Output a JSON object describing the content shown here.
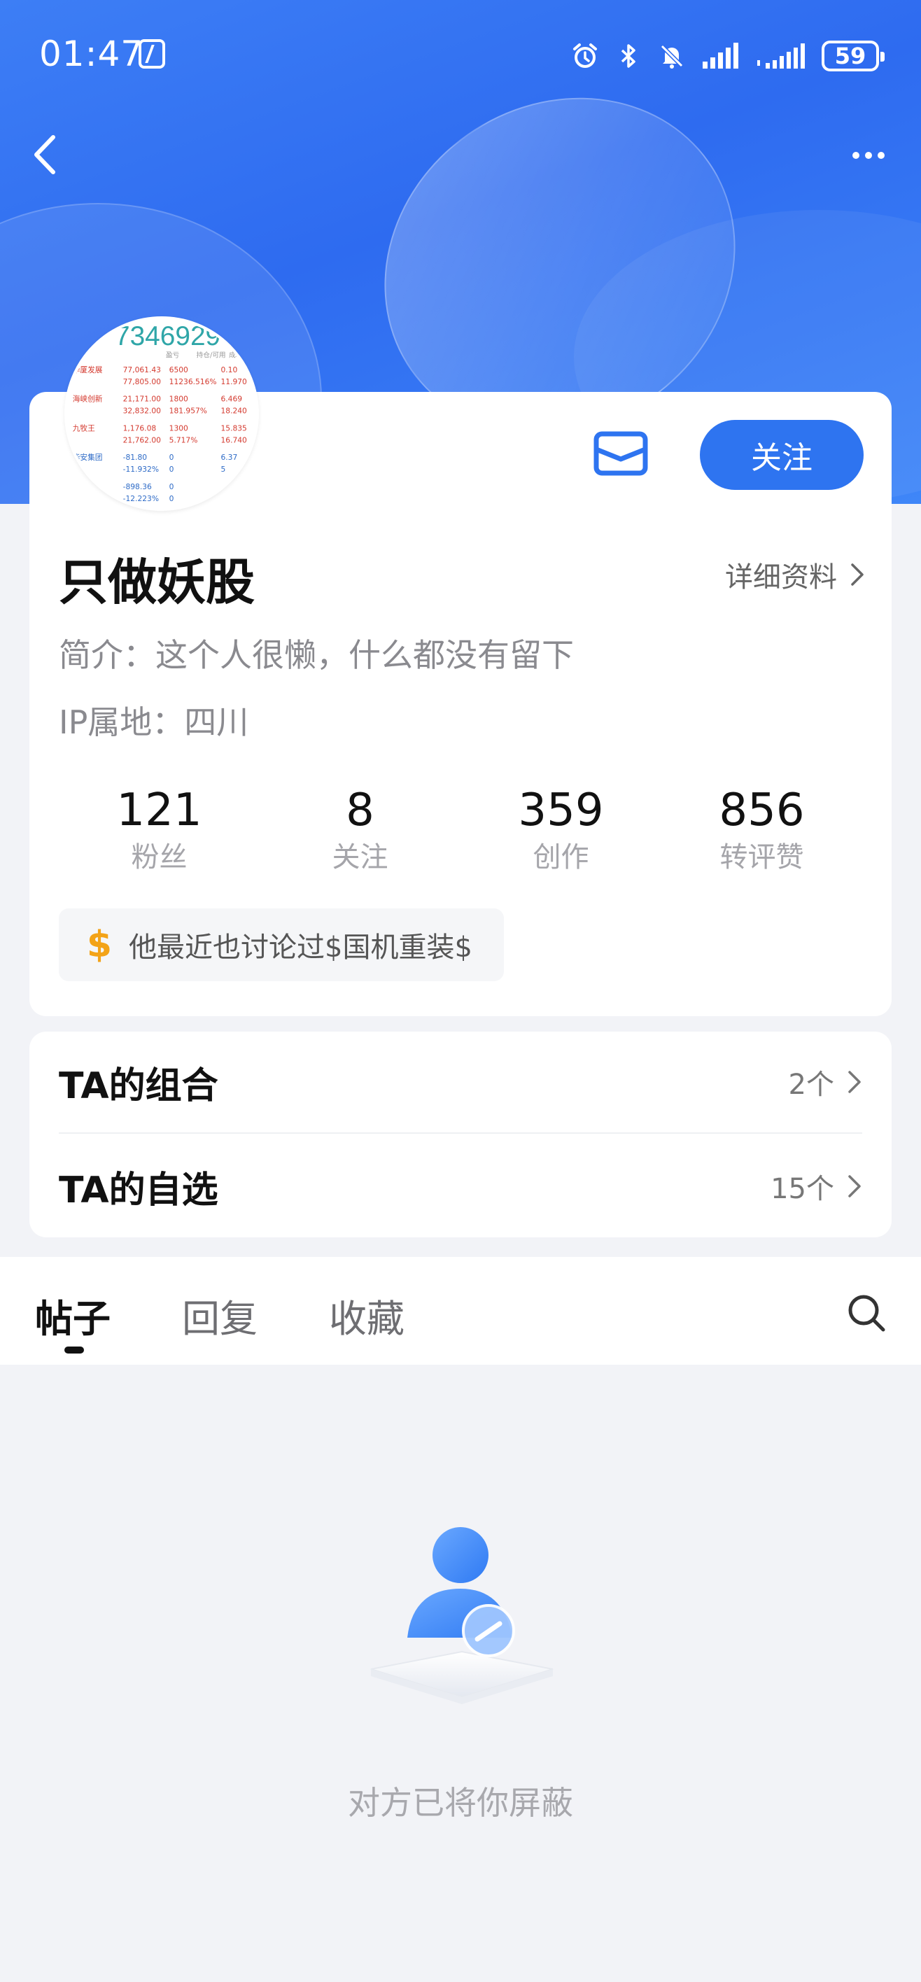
{
  "status_bar": {
    "time": "01:47",
    "battery": "59"
  },
  "nav": {
    "back_icon": "chevron-left-icon",
    "more_icon": "more-horizontal-icon"
  },
  "profile": {
    "follow_label": "关注",
    "username": "只做妖股",
    "detail_label": "详细资料",
    "bio": "简介：这个人很懒，什么都没有留下",
    "ip": "IP属地：四川",
    "stats": [
      {
        "num": "121",
        "label": "粉丝"
      },
      {
        "num": "8",
        "label": "关注"
      },
      {
        "num": "359",
        "label": "创作"
      },
      {
        "num": "856",
        "label": "转评赞"
      }
    ],
    "discussion": "他最近也讨论过$国机重装$",
    "avatar_text": {
      "header": "7346929",
      "cols": [
        "盈亏",
        "持仓/可用",
        "成本/现"
      ],
      "rows": [
        {
          "name": "华厦发展",
          "v1": "77,061.43",
          "v2": "6500",
          "v3": "0.10"
        },
        {
          "name": "",
          "v1": "77,805.00",
          "v2": "11236.516%",
          "v3": "11.970"
        },
        {
          "name": "海峡创新",
          "v1": "21,171.00",
          "v2": "1800",
          "v3": "6.469"
        },
        {
          "name": "",
          "v1": "32,832.00",
          "v2": "181.957%",
          "v3": "18.240"
        },
        {
          "name": "九牧王",
          "v1": "1,176.08",
          "v2": "1300",
          "v3": "15.835"
        },
        {
          "name": "",
          "v1": "21,762.00",
          "v2": "5.717%",
          "v3": "16.740"
        },
        {
          "name": "华安集团",
          "v1": "-81.80",
          "v2": "0",
          "v3": "6.37"
        },
        {
          "name": "",
          "v1": "-11.932%",
          "v2": "0",
          "v3": "5"
        },
        {
          "name": "",
          "v1": "-898.36",
          "v2": "0",
          "v3": ""
        },
        {
          "name": "",
          "v1": "-12.223%",
          "v2": "0",
          "v3": ""
        }
      ]
    }
  },
  "ta": {
    "portfolio_label": "TA的组合",
    "portfolio_count": "2个",
    "watchlist_label": "TA的自选",
    "watchlist_count": "15个"
  },
  "tabs": [
    "帖子",
    "回复",
    "收藏"
  ],
  "empty_message": "对方已将你屏蔽",
  "colors": {
    "accent": "#2e74f0",
    "dollar": "#f3a318"
  }
}
